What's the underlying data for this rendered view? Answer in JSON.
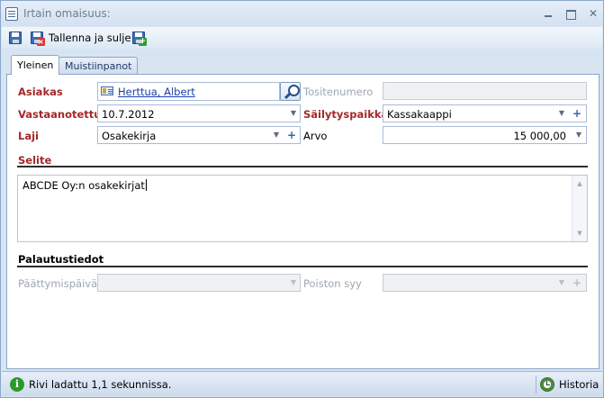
{
  "window": {
    "title": "Irtain omaisuus:"
  },
  "toolbar": {
    "save_close_label": "Tallenna ja sulje"
  },
  "tabs": [
    {
      "label": "Yleinen",
      "active": true
    },
    {
      "label": "Muistiinpanot",
      "active": false
    }
  ],
  "form": {
    "asiakas": {
      "label": "Asiakas",
      "value": "Herttua, Albert"
    },
    "tositenumero": {
      "label": "Tositenumero",
      "value": ""
    },
    "vastaanotettu": {
      "label": "Vastaanotettu",
      "value": "10.7.2012"
    },
    "sailytyspaikka": {
      "label": "Säilytyspaikka",
      "value": "Kassakaappi"
    },
    "laji": {
      "label": "Laji",
      "value": "Osakekirja"
    },
    "arvo": {
      "label": "Arvo",
      "value": "15 000,00"
    },
    "selite": {
      "label": "Selite",
      "value": "ABCDE Oy:n osakekirjat"
    }
  },
  "palautus": {
    "section_label": "Palautustiedot",
    "paattymispaiva": {
      "label": "Päättymispäivä",
      "value": ""
    },
    "poiston_syy": {
      "label": "Poiston syy",
      "value": ""
    }
  },
  "status": {
    "message": "Rivi ladattu 1,1 sekunnissa.",
    "history_label": "Historia"
  },
  "colors": {
    "required_label": "#a3282b",
    "link": "#1a3fa8",
    "frame": "#d7e4f2"
  },
  "icons": {
    "window": "form-icon",
    "save": "save-icon",
    "save_close": "save-close-icon",
    "save_new": "save-new-icon",
    "contact": "contact-card-icon",
    "lookup": "magnifier-icon",
    "status": "info-icon",
    "history": "history-clock-icon"
  }
}
